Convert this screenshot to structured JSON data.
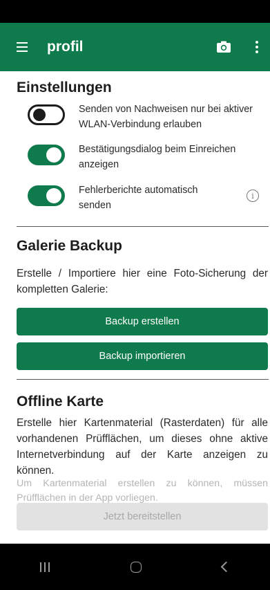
{
  "appbar": {
    "title": "profil",
    "menu_icon": "hamburger-menu-icon",
    "camera_icon": "camera-icon",
    "overflow_icon": "more-vert-icon",
    "color": "#0f7a4b"
  },
  "settings": {
    "title": "Einstellungen",
    "items": [
      {
        "label": "Senden von Nachweisen nur bei aktiver WLAN-Verbindung erlauben",
        "enabled": false
      },
      {
        "label": "Bestätigungsdialog beim Einreichen anzeigen",
        "enabled": true
      },
      {
        "label": "Fehlerberichte automatisch senden",
        "enabled": true,
        "info_icon": "info-icon"
      }
    ]
  },
  "backup": {
    "title": "Galerie Backup",
    "description": "Erstelle / Importiere hier eine Foto-Sicherung der kompletten Galerie:",
    "create_label": "Backup erstellen",
    "import_label": "Backup importieren"
  },
  "offline": {
    "title": "Offline Karte",
    "description": "Erstelle hier Kartenmaterial (Rasterdaten) für alle vorhandenen Prüfflächen, um dieses ohne aktive Internetverbindung auf der Karte anzeigen zu können.",
    "hint": "Um Kartenmaterial erstellen zu können, müssen Prüfflächen in der App vorliegen.",
    "provide_label": "Jetzt bereitstellen"
  },
  "navbar": {
    "recent_icon": "recent-apps-icon",
    "home_icon": "home-icon",
    "back_icon": "back-icon"
  }
}
